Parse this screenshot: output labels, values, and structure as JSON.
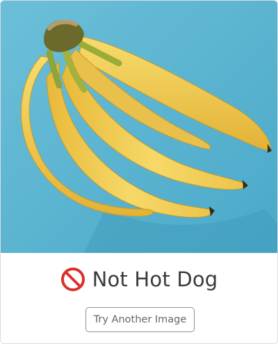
{
  "image": {
    "subject": "bunch of bananas on blue background"
  },
  "result": {
    "icon": "prohibited-icon",
    "label": "Not Hot Dog",
    "icon_color": "#d9302a"
  },
  "actions": {
    "retry_label": "Try Another Image"
  },
  "colors": {
    "photo_background": "#5fb6d2",
    "banana": "#f2cf5b",
    "text": "#3a3a3a"
  }
}
